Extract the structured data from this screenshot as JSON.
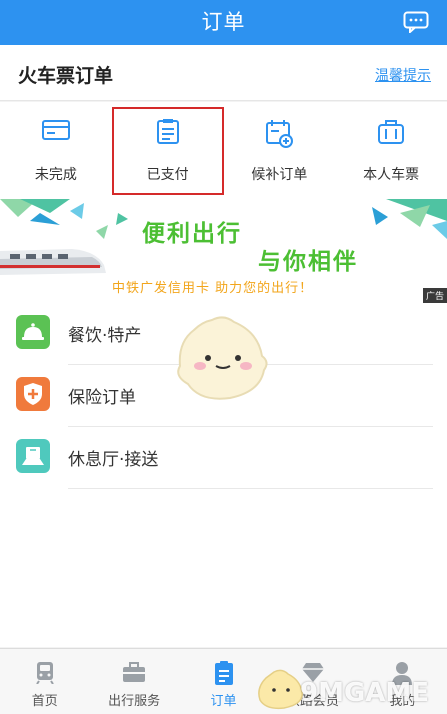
{
  "header": {
    "title": "订单",
    "chat_icon": "chat-icon"
  },
  "section": {
    "title": "火车票订单",
    "tip": "温馨提示"
  },
  "quick": [
    {
      "label": "未完成",
      "icon": "unfinished-card-icon"
    },
    {
      "label": "已支付",
      "icon": "paid-document-icon",
      "highlighted": true
    },
    {
      "label": "候补订单",
      "icon": "waitlist-calendar-icon"
    },
    {
      "label": "本人车票",
      "icon": "ticket-suitcase-icon"
    }
  ],
  "banner": {
    "slogan1": "便利出行",
    "slogan2": "与你相伴",
    "promo": "中铁广发信用卡  助力您的出行！",
    "ad": "广告"
  },
  "services": [
    {
      "label": "餐饮·特产",
      "icon": "dining-bell-icon",
      "color": "#5bc254"
    },
    {
      "label": "保险订单",
      "icon": "insurance-shield-icon",
      "color": "#f07a3c"
    },
    {
      "label": "休息厅·接送",
      "icon": "lounge-icon",
      "color": "#4fc9bd"
    }
  ],
  "tabs": [
    {
      "label": "首页",
      "icon": "home-train-icon"
    },
    {
      "label": "出行服务",
      "icon": "briefcase-icon"
    },
    {
      "label": "订单",
      "icon": "order-list-icon",
      "active": true
    },
    {
      "label": "铁路会员",
      "icon": "member-diamond-icon"
    },
    {
      "label": "我的",
      "icon": "profile-icon"
    }
  ],
  "watermark": "9MGAME",
  "colors": {
    "primary": "#2d92f0",
    "highlight_border": "#d52a2a",
    "slogan_green": "#4cbf33",
    "promo_orange": "#f2a51b"
  }
}
